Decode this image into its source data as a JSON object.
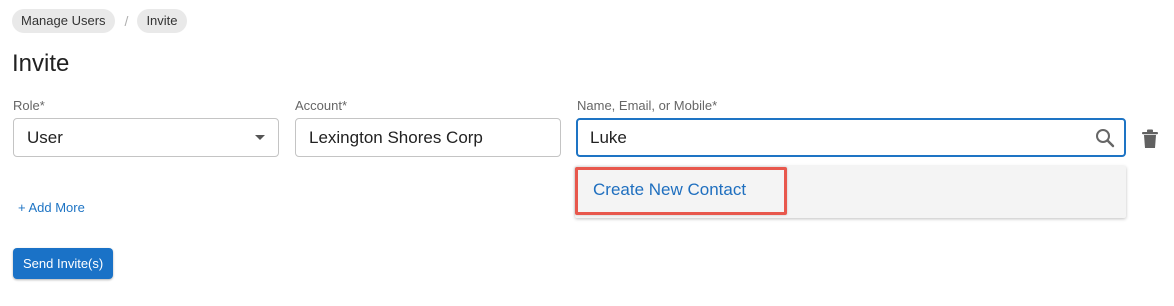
{
  "breadcrumb": {
    "items": [
      "Manage Users",
      "Invite"
    ],
    "separator": "/"
  },
  "page": {
    "title": "Invite"
  },
  "form": {
    "role": {
      "label": "Role*",
      "value": "User"
    },
    "account": {
      "label": "Account*",
      "value": "Lexington Shores Corp"
    },
    "contact": {
      "label": "Name, Email, or Mobile*",
      "value": "Luke"
    }
  },
  "dropdown": {
    "options": [
      "Create New Contact"
    ]
  },
  "actions": {
    "add_more": "+ Add More",
    "send": "Send Invite(s)"
  },
  "colors": {
    "primary": "#1a72c7",
    "focus_border": "#1e74c4",
    "highlight_border": "#e8584d",
    "link": "#1f6fbf"
  },
  "icons": [
    "chevron-down-icon",
    "search-icon",
    "trash-icon"
  ]
}
